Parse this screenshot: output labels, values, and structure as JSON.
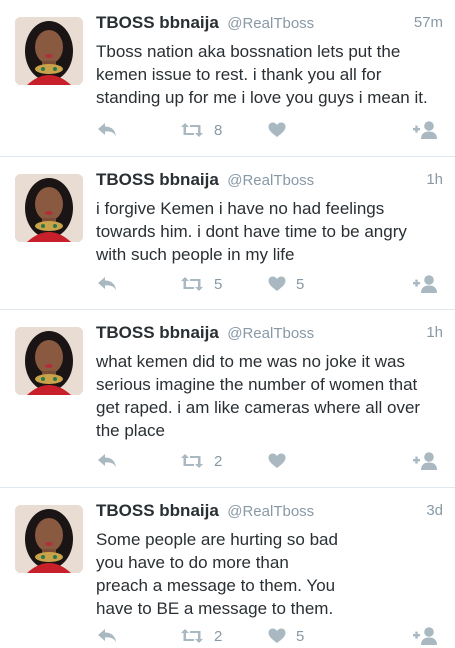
{
  "tweets": [
    {
      "name": "TBOSS bbnaija",
      "handle": "@RealTboss",
      "time": "57m",
      "text": "Tboss nation aka bossnation lets put the\nkemen issue to rest. i thank you all for\nstanding up for me i love you guys i mean it.",
      "retweets": "8",
      "likes": ""
    },
    {
      "name": "TBOSS bbnaija",
      "handle": "@RealTboss",
      "time": "1h",
      "text": "i forgive Kemen i have no had feelings\ntowards him. i dont have time to be angry\nwith such people in my  life",
      "retweets": "5",
      "likes": "5"
    },
    {
      "name": "TBOSS bbnaija",
      "handle": "@RealTboss",
      "time": "1h",
      "text": "what kemen did to me was no joke it was\nserious imagine the number of women that\nget raped. i am like cameras where all over\nthe place",
      "retweets": "2",
      "likes": ""
    },
    {
      "name": "TBOSS bbnaija",
      "handle": "@RealTboss",
      "time": "3d",
      "text": "Some people are hurting so bad\nyou have to do more than\npreach a message to them. You\nhave to BE a message to them.",
      "retweets": "2",
      "likes": "5"
    }
  ],
  "icons": {
    "reply": "reply-icon",
    "retweet": "retweet-icon",
    "like": "heart-icon",
    "follow": "follow-icon"
  },
  "colors": {
    "text": "#292f33",
    "muted": "#8899a6",
    "icon": "#aab8c2",
    "divider": "#e1e8ed"
  }
}
